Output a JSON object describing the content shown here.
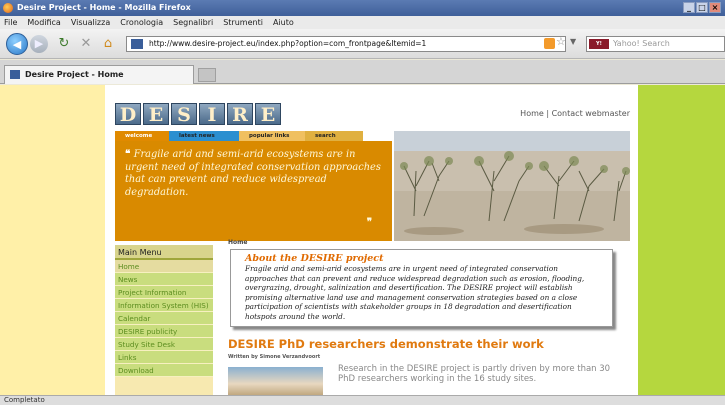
{
  "window": {
    "title": "Desire Project - Home - Mozilla Firefox"
  },
  "menu": [
    "File",
    "Modifica",
    "Visualizza",
    "Cronologia",
    "Segnalibri",
    "Strumenti",
    "Aiuto"
  ],
  "nav": {
    "url": "http://www.desire-project.eu/index.php?option=com_frontpage&Itemid=1",
    "search_placeholder": "Yahoo! Search",
    "search_engine": "Y!"
  },
  "tab": {
    "title": "Desire Project - Home"
  },
  "page": {
    "logo_letters": [
      "D",
      "E",
      "S",
      "I",
      "R",
      "E"
    ],
    "top_links": {
      "home": "Home",
      "separator": " | ",
      "contact": "Contact webmaster"
    },
    "hero_tabs": [
      "welcome",
      "latest news",
      "popular links",
      "search"
    ],
    "hero_quote": "Fragile arid and semi-arid ecosystems are in urgent need of integrated conservation approaches that can prevent and reduce widespread degradation.",
    "sidebar": {
      "title": "Main Menu",
      "items": [
        "Home",
        "News",
        "Project Information",
        "Information System (HIS)",
        "Calendar",
        "DESIRE publicity",
        "Study Site Desk",
        "Links",
        "Download"
      ]
    },
    "breadcrumb": "Home",
    "about": {
      "title": "About the DESIRE project",
      "text": "Fragile arid and semi-arid ecosystems are in urgent need of integrated conservation approaches that can prevent and reduce widespread degradation such as erosion, flooding, overgrazing, drought, salinization and desertification. The DESIRE project will establish promising alternative land use and management conservation strategies based on a close participation of scientists with stakeholder groups in 18 degradation and desertification hotspots around the world."
    },
    "article": {
      "title": "DESIRE PhD researchers demonstrate their work",
      "byline": "Written by Simone Verzandvoort",
      "intro": "Research in the DESIRE project is partly driven by more than 30 PhD researchers working in the 16 study sites."
    }
  },
  "status": "Completato",
  "colors": {
    "left_bg": "#fff0a8",
    "right_bg": "#b5d73e",
    "accent_orange": "#d98a00"
  }
}
